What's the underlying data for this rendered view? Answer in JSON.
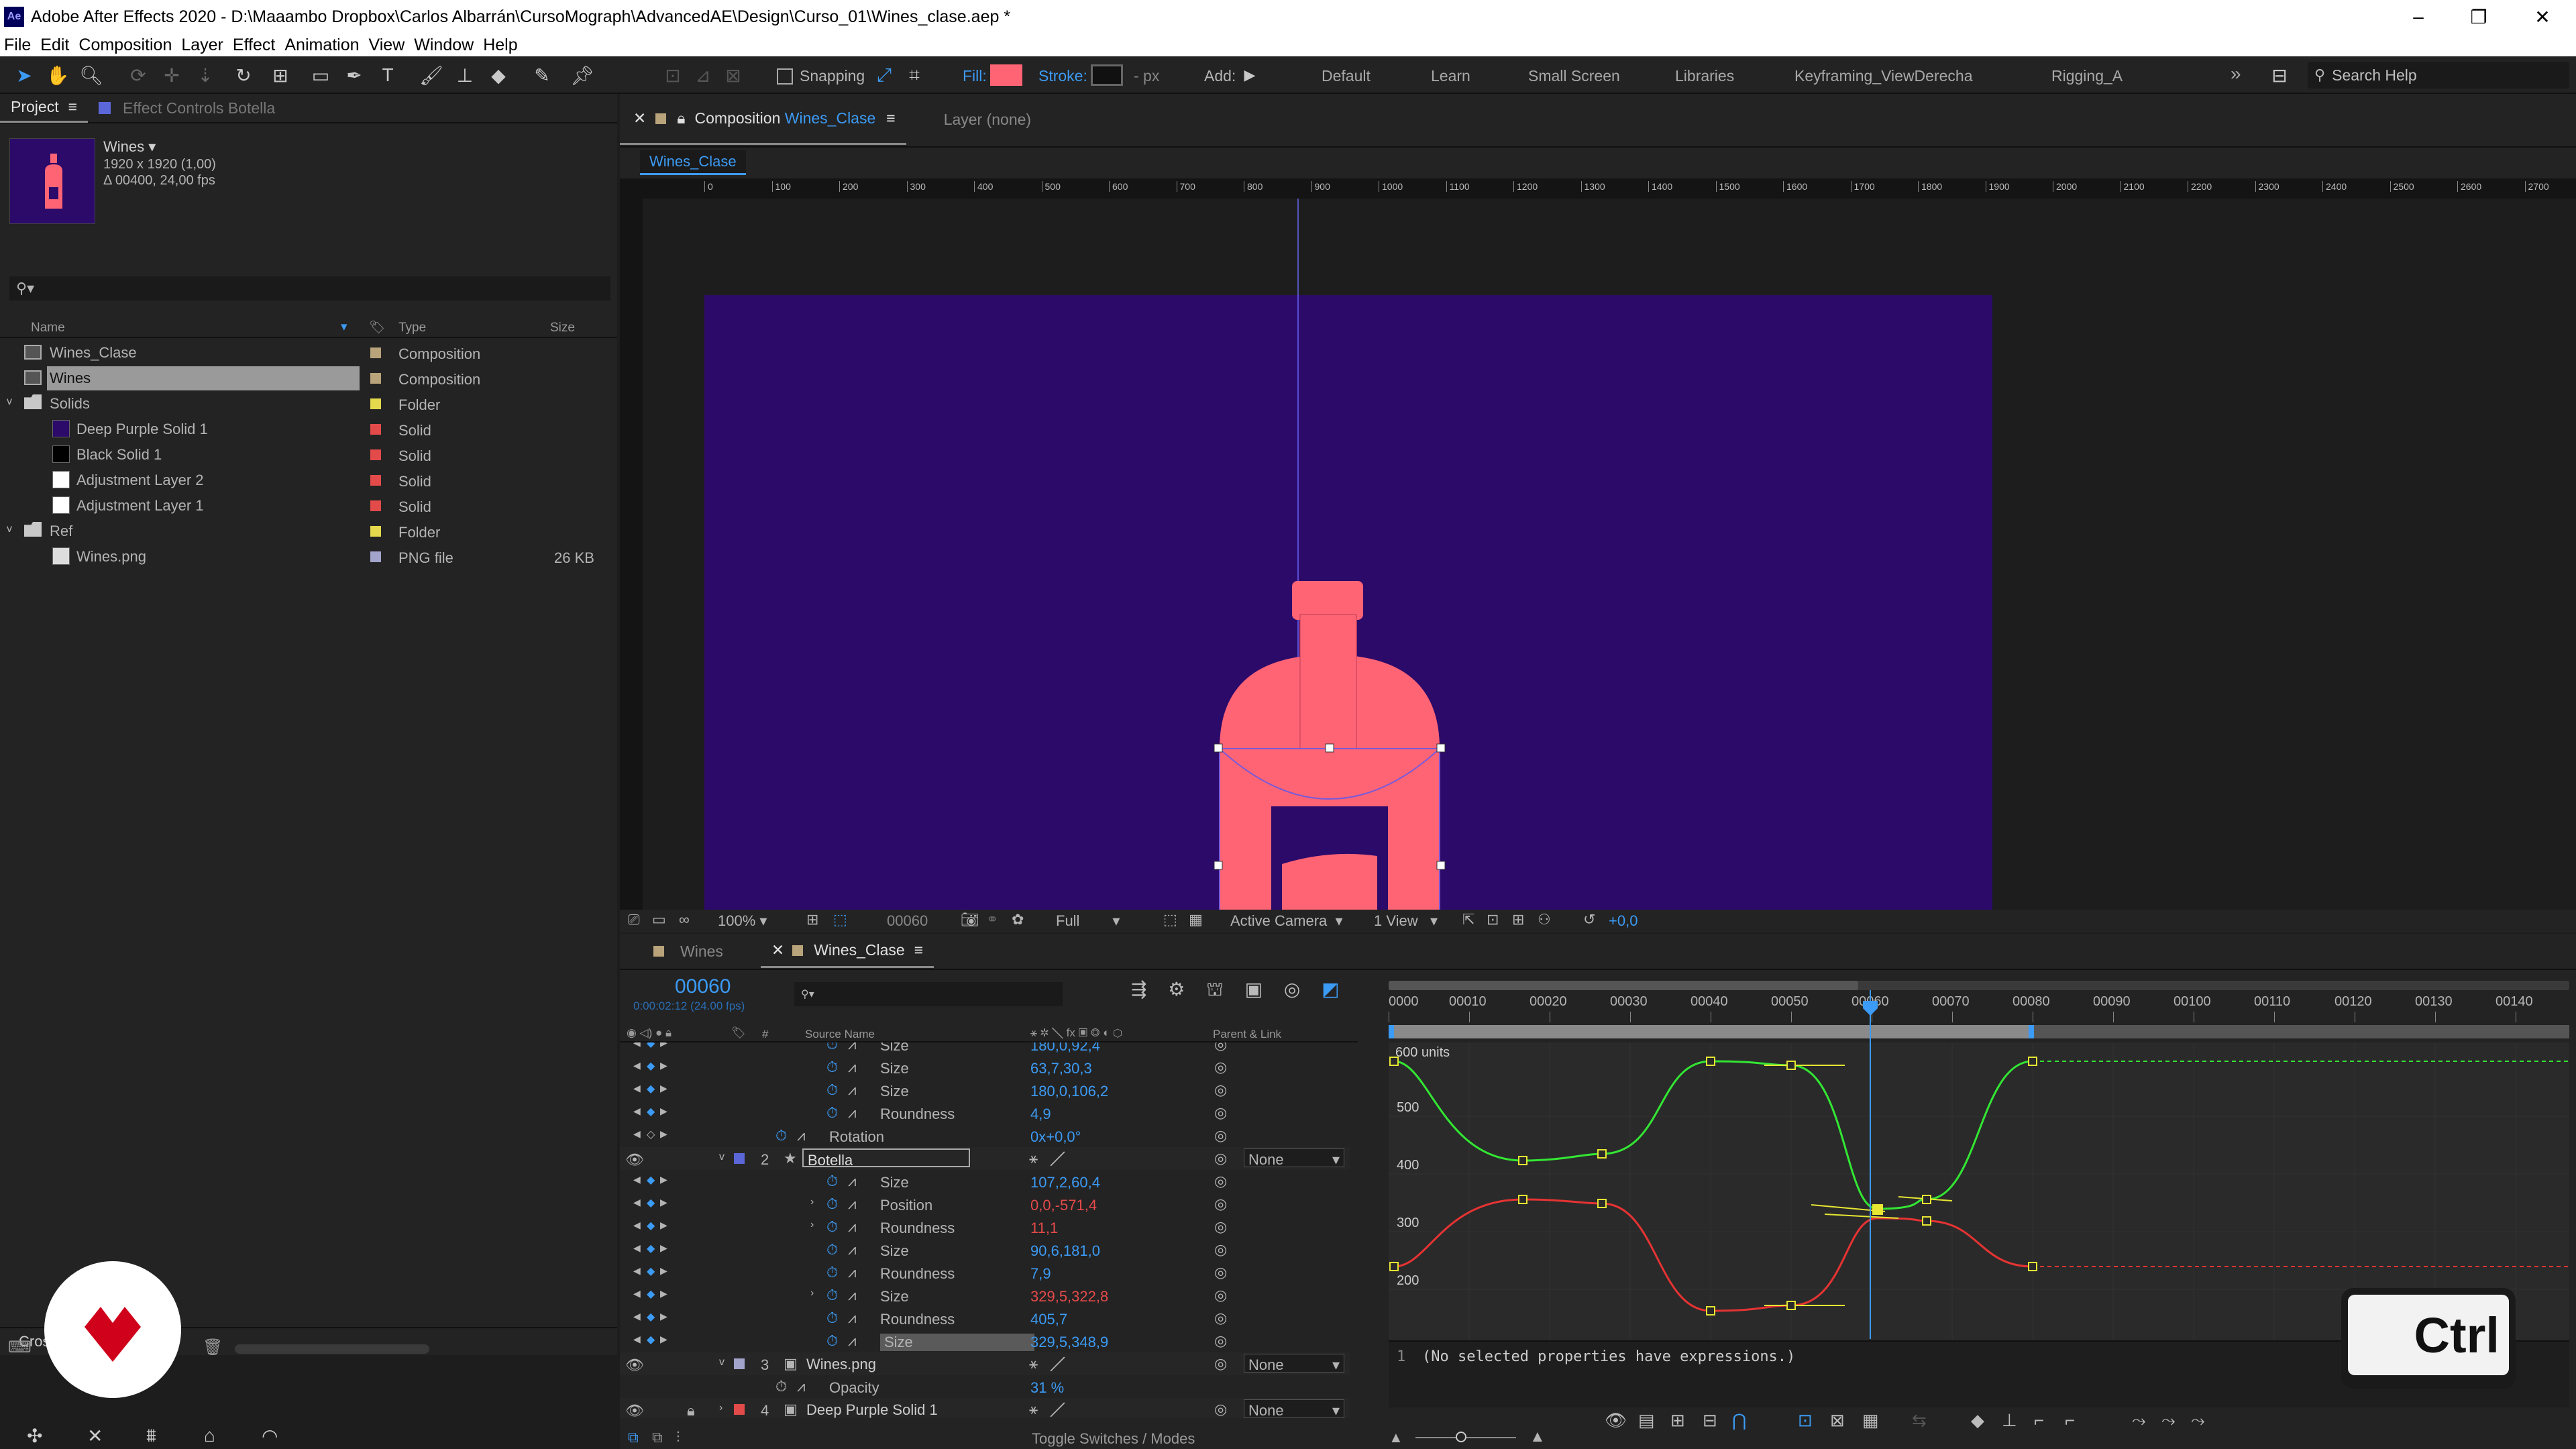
{
  "window": {
    "title": "Adobe After Effects 2020 - D:\\Maaambo Dropbox\\Carlos Albarrán\\CursoMograph\\AdvancedAE\\Design\\Curso_01\\Wines_clase.aep *",
    "app_badge": "Ae",
    "minimize": "–",
    "restore": "❐",
    "close": "✕"
  },
  "menu": [
    "File",
    "Edit",
    "Composition",
    "Layer",
    "Effect",
    "Animation",
    "View",
    "Window",
    "Help"
  ],
  "toolbar": {
    "snapping_label": "Snapping",
    "fill_label": "Fill:",
    "stroke_label": "Stroke:",
    "px_label": "- px",
    "add_label": "Add:",
    "fill_color": "#ff6475",
    "workspaces": [
      "Default",
      "Learn",
      "Small Screen",
      "Libraries",
      "Keyframing_ViewDerecha",
      "Rigging_A"
    ],
    "more": "»",
    "search_placeholder": "Search Help"
  },
  "project_panel": {
    "tab_project": "Project",
    "tab_effect_controls": "Effect Controls Botella",
    "thumb_name": "Wines",
    "thumb_dims": "1920 x 1920 (1,00)",
    "thumb_fps": "Δ 00400, 24,00 fps",
    "search_icon": "search-icon",
    "col_name": "Name",
    "col_type": "Type",
    "col_size": "Size",
    "items": [
      {
        "name": "Wines_Clase",
        "type": "Composition",
        "size": "",
        "label": "#b9a37a",
        "indent": 0
      },
      {
        "name": "Wines",
        "type": "Composition",
        "size": "",
        "label": "#b9a37a",
        "indent": 0
      },
      {
        "name": "Solids",
        "type": "Folder",
        "size": "",
        "label": "#e4d84c",
        "indent": 0
      },
      {
        "name": "Deep Purple Solid 1",
        "type": "Solid",
        "size": "",
        "label": "#e34b4b",
        "indent": 1
      },
      {
        "name": "Black Solid 1",
        "type": "Solid",
        "size": "",
        "label": "#e34b4b",
        "indent": 1
      },
      {
        "name": "Adjustment Layer 2",
        "type": "Solid",
        "size": "",
        "label": "#e34b4b",
        "indent": 1
      },
      {
        "name": "Adjustment Layer 1",
        "type": "Solid",
        "size": "",
        "label": "#e34b4b",
        "indent": 1
      },
      {
        "name": "Ref",
        "type": "Folder",
        "size": "",
        "label": "#e4d84c",
        "indent": 0
      },
      {
        "name": "Wines.png",
        "type": "PNG file",
        "size": "26 KB",
        "label": "#a3a4cc",
        "indent": 1
      }
    ],
    "bpc_label": "Crosshair"
  },
  "comp_panel": {
    "tab_label": "Composition",
    "tab_comp_name": "Wines_Clase",
    "layer_label": "Layer (none)",
    "breadcrumb": "Wines_Clase",
    "ruler_ticks": [
      "0",
      "100",
      "200",
      "300",
      "400",
      "500",
      "600",
      "700",
      "800",
      "900",
      "1000",
      "1100",
      "1200",
      "1300",
      "1400",
      "1500",
      "1600",
      "1700",
      "1800",
      "1900",
      "2000",
      "2100",
      "2200",
      "2300",
      "2400",
      "2500",
      "2600",
      "2700"
    ],
    "bg_color": "#2c0a6a",
    "bottle_color": "#ff6475",
    "zoom": "100%",
    "timecode": "00060",
    "resolution": "Full",
    "camera": "Active Camera",
    "views": "1 View",
    "exposure": "+0,0"
  },
  "timeline": {
    "tab_wines": "Wines",
    "tab_wines_clase": "Wines_Clase",
    "current_time": "00060",
    "current_time_sub": "0:00:02:12 (24.00 fps)",
    "col_source_name": "Source Name",
    "col_parent": "Parent & Link",
    "col_hash": "#",
    "time_ticks": [
      "0000",
      "00010",
      "00020",
      "00030",
      "00040",
      "00050",
      "00060",
      "00070",
      "00080",
      "00090",
      "00100",
      "00110",
      "00120",
      "00130",
      "00140"
    ],
    "rows": [
      {
        "kind": "prop",
        "name": "Size",
        "value": "180,0,92,4",
        "value_color": "blue",
        "indent": 2
      },
      {
        "kind": "prop",
        "name": "Size",
        "value": "63,7,30,3",
        "value_color": "blue",
        "indent": 2
      },
      {
        "kind": "prop",
        "name": "Size",
        "value": "180,0,106,2",
        "value_color": "blue",
        "indent": 2
      },
      {
        "kind": "prop",
        "name": "Roundness",
        "value": "4,9",
        "value_color": "blue",
        "indent": 2
      },
      {
        "kind": "prop",
        "name": "Rotation",
        "value": "0x+0,0°",
        "value_color": "blue",
        "indent": 1
      },
      {
        "kind": "layer",
        "num": "2",
        "name": "Botella",
        "parent": "None",
        "label": "#5b67d8"
      },
      {
        "kind": "prop",
        "name": "Size",
        "value": "107,2,60,4",
        "value_color": "blue",
        "indent": 2
      },
      {
        "kind": "prop",
        "name": "Position",
        "value": "0,0,-571,4",
        "value_color": "red",
        "indent": 2
      },
      {
        "kind": "prop",
        "name": "Roundness",
        "value": "11,1",
        "value_color": "red",
        "indent": 2
      },
      {
        "kind": "prop",
        "name": "Size",
        "value": "90,6,181,0",
        "value_color": "blue",
        "indent": 2
      },
      {
        "kind": "prop",
        "name": "Roundness",
        "value": "7,9",
        "value_color": "blue",
        "indent": 2
      },
      {
        "kind": "prop",
        "name": "Size",
        "value": "329,5,322,8",
        "value_color": "red",
        "indent": 2
      },
      {
        "kind": "prop",
        "name": "Roundness",
        "value": "405,7",
        "value_color": "blue",
        "indent": 2
      },
      {
        "kind": "prop",
        "name": "Size",
        "value": "329,5,348,9",
        "value_color": "blue",
        "indent": 2
      },
      {
        "kind": "layer",
        "num": "3",
        "name": "Wines.png",
        "parent": "None",
        "label": "#a3a4cc"
      },
      {
        "kind": "prop",
        "name": "Opacity",
        "value": "31 %",
        "value_color": "blue",
        "indent": 1
      },
      {
        "kind": "layer",
        "num": "4",
        "name": "Deep Purple Solid 1",
        "parent": "None",
        "label": "#e34b4b"
      }
    ],
    "graph": {
      "units_label": "600 units",
      "y_labels": [
        "500",
        "400",
        "300",
        "200"
      ],
      "expression_text": "(No selected properties have expressions.)",
      "expression_line": "1"
    },
    "toggle_label": "Toggle Switches / Modes"
  },
  "overlay": {
    "ctrl_key": "Ctrl"
  }
}
